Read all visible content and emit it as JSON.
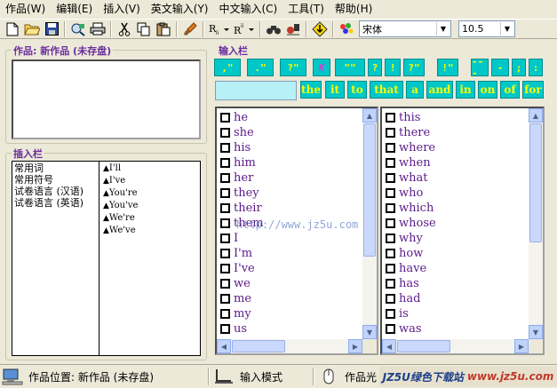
{
  "menu": [
    "作品(W)",
    "编辑(E)",
    "插入(V)",
    "英文输入(Y)",
    "中文输入(C)",
    "工具(T)",
    "帮助(H)"
  ],
  "toolbar": {
    "font": "宋体",
    "size": "10.5"
  },
  "work_panel": {
    "title": "作品: 新作品 (未存盘)"
  },
  "insert_panel": {
    "title": "插入栏",
    "categories": [
      "常用词",
      "常用符号",
      "试卷语言 (汉语)",
      "试卷语言 (英语)"
    ],
    "phrases": [
      "I'll",
      "I've",
      "You're",
      "You've",
      "We're",
      "We've"
    ]
  },
  "input_panel": {
    "title": "输入栏",
    "punct": [
      ",\"",
      ".\"",
      "?\"",
      "K",
      "\"\"",
      "?",
      "!",
      "?\"",
      "!\"",
      "---",
      "-",
      ";",
      ":"
    ],
    "words": [
      "the",
      "it",
      "to",
      "that",
      "a",
      "and",
      "in",
      "on",
      "of",
      "for"
    ],
    "input_value": ""
  },
  "word_list_left": [
    "he",
    "she",
    "his",
    "him",
    "her",
    "they",
    "their",
    "them",
    "I",
    "I'm",
    "I've",
    "we",
    "me",
    "my",
    "us"
  ],
  "word_list_right": [
    "this",
    "there",
    "where",
    "when",
    "what",
    "who",
    "which",
    "whose",
    "why",
    "how",
    "have",
    "has",
    "had",
    "is",
    "was"
  ],
  "watermark": "http://www.jz5u.com",
  "status": {
    "location": "作品位置: 新作品 (未存盘)",
    "mode": "输入模式",
    "cursor": "作品光",
    "banner_a": "JZ5U绿色下载站",
    "banner_b": "www.jz5u.com"
  }
}
